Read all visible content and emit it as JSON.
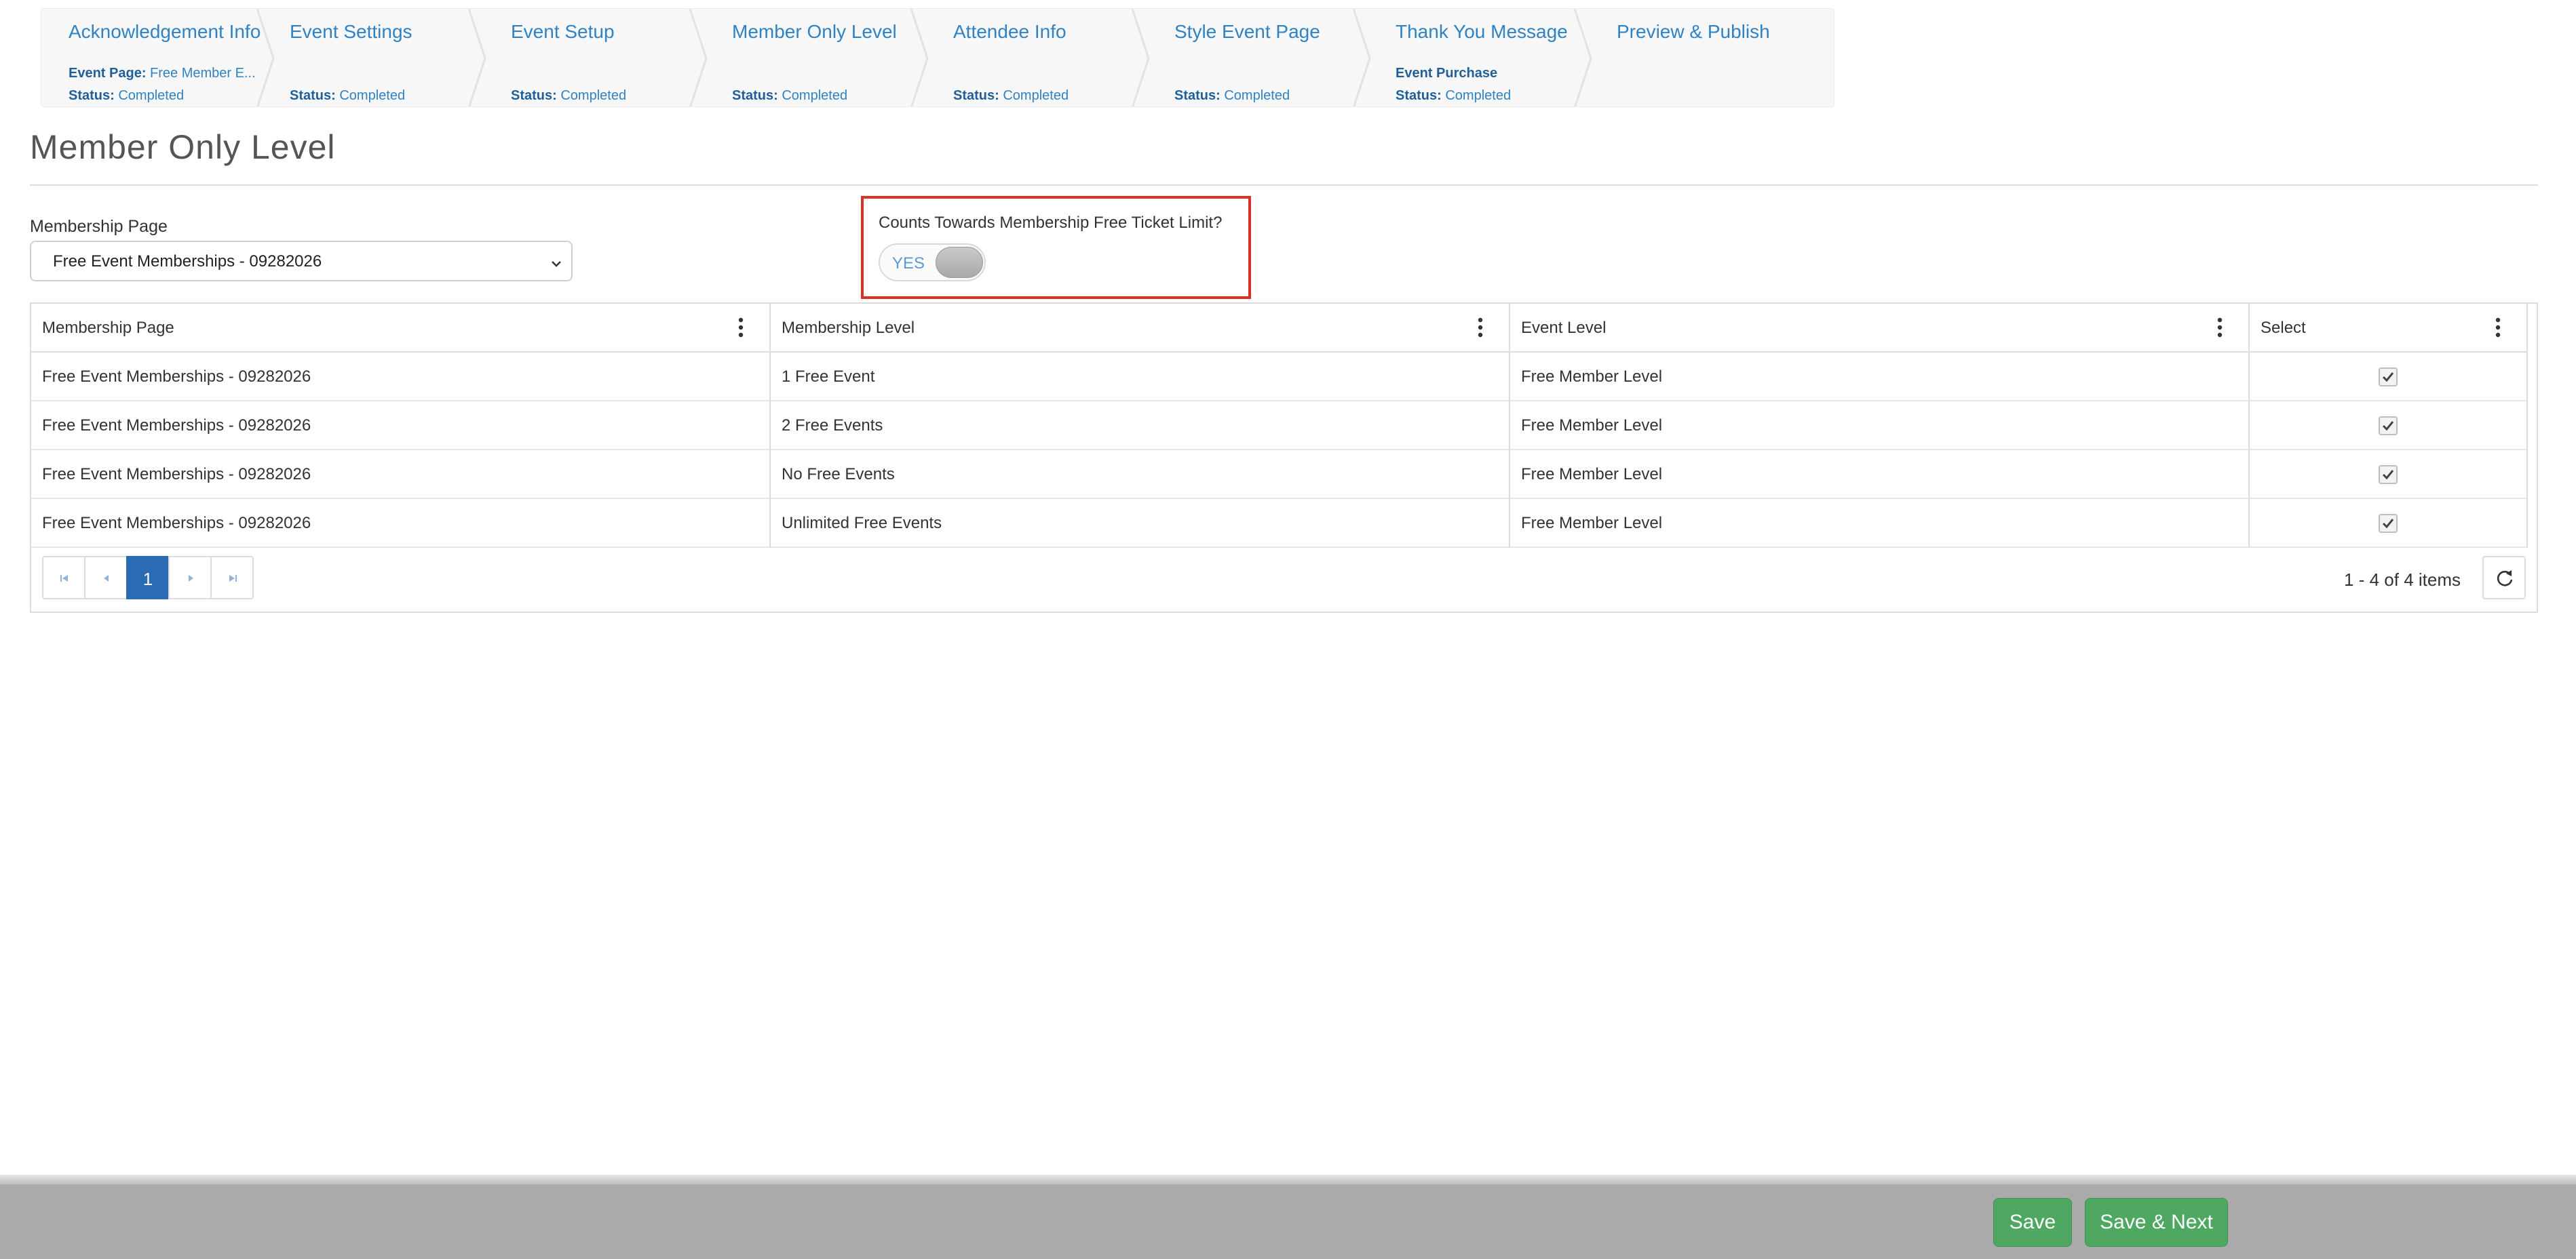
{
  "steps": [
    {
      "title": "Acknowledgement Info",
      "meta1_label": "Event Page:",
      "meta1_value": " Free Member E...",
      "meta2_label": "Status:",
      "meta2_value": " Completed"
    },
    {
      "title": "Event Settings",
      "meta1_label": "",
      "meta1_value": "",
      "meta2_label": "Status:",
      "meta2_value": " Completed"
    },
    {
      "title": "Event Setup",
      "meta1_label": "",
      "meta1_value": "",
      "meta2_label": "Status:",
      "meta2_value": " Completed"
    },
    {
      "title": "Member Only Level",
      "meta1_label": "",
      "meta1_value": "",
      "meta2_label": "Status:",
      "meta2_value": " Completed"
    },
    {
      "title": "Attendee Info",
      "meta1_label": "",
      "meta1_value": "",
      "meta2_label": "Status:",
      "meta2_value": " Completed"
    },
    {
      "title": "Style Event Page",
      "meta1_label": "",
      "meta1_value": "",
      "meta2_label": "Status:",
      "meta2_value": " Completed"
    },
    {
      "title": "Thank You Message",
      "meta1_label": "Event Purchase",
      "meta1_value": "",
      "meta2_label": "Status:",
      "meta2_value": " Completed"
    },
    {
      "title": "Preview & Publish",
      "meta1_label": "",
      "meta1_value": "",
      "meta2_label": "",
      "meta2_value": ""
    }
  ],
  "page_title": "Member Only Level",
  "membership_select": {
    "label": "Membership Page",
    "value": "Free Event Memberships - 09282026"
  },
  "free_ticket_toggle": {
    "label": "Counts Towards Membership Free Ticket Limit?",
    "state_text": "YES"
  },
  "grid": {
    "columns": [
      "Membership Page",
      "Membership Level",
      "Event Level",
      "Select"
    ],
    "rows": [
      {
        "membership_page": "Free Event Memberships - 09282026",
        "membership_level": "1 Free Event",
        "event_level": "Free Member Level",
        "selected": true
      },
      {
        "membership_page": "Free Event Memberships - 09282026",
        "membership_level": "2 Free Events",
        "event_level": "Free Member Level",
        "selected": true
      },
      {
        "membership_page": "Free Event Memberships - 09282026",
        "membership_level": "No Free Events",
        "event_level": "Free Member Level",
        "selected": true
      },
      {
        "membership_page": "Free Event Memberships - 09282026",
        "membership_level": "Unlimited Free Events",
        "event_level": "Free Member Level",
        "selected": true
      }
    ],
    "pager": {
      "current_page": "1",
      "info": "1 - 4 of 4 items"
    }
  },
  "footer": {
    "save_label": "Save",
    "save_next_label": "Save & Next"
  },
  "colors": {
    "link_blue": "#2f82c4",
    "highlight_red": "#d93226",
    "button_green": "#4ea862",
    "pager_active": "#2a6bb3"
  },
  "icons": {
    "step_separator": "chevron-right-icon",
    "select_caret": "chevron-down-icon",
    "column_menu": "kebab-menu-icon",
    "checkbox": "checkmark-icon",
    "pager_first": "first-page-icon",
    "pager_prev": "previous-page-icon",
    "pager_next": "next-page-icon",
    "pager_last": "last-page-icon",
    "refresh": "refresh-icon"
  }
}
